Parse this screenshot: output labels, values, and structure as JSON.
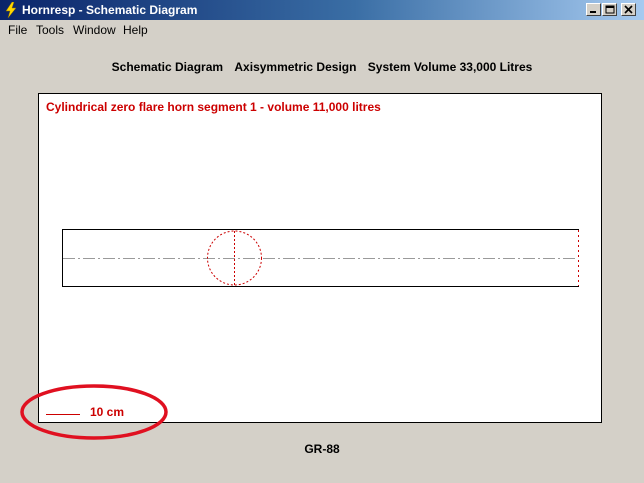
{
  "window": {
    "title": "Hornresp - Schematic Diagram"
  },
  "menu": [
    "File",
    "Tools",
    "Window",
    "Help"
  ],
  "header": {
    "diagram_type": "Schematic Diagram",
    "design": "Axisymmetric Design",
    "system_volume": "System Volume 33,000 Litres"
  },
  "canvas": {
    "segment_title": "Cylindrical zero flare horn segment 1 - volume 11,000 litres",
    "scale_label": "10 cm"
  },
  "footer": {
    "model": "GR-88"
  },
  "colors": {
    "annotation_red": "#cc0000",
    "highlight_ellipse": "#e01020",
    "title_gradient_start": "#0a246a"
  }
}
